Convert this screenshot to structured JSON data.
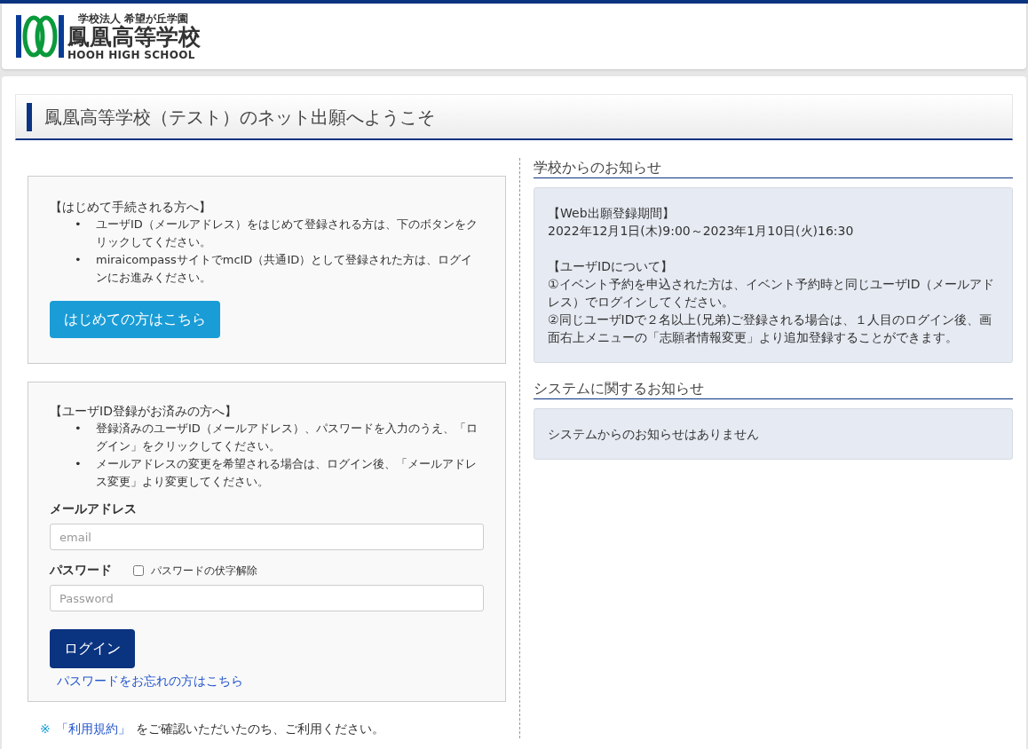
{
  "header": {
    "logo_caption": "学校法人 希望が丘学園",
    "logo_name": "鳳凰高等学校",
    "logo_english": "HOOH HIGH SCHOOL"
  },
  "page_title": "鳳凰高等学校（テスト）のネット出願へようこそ",
  "first_time": {
    "heading": "【はじめて手続される方へ】",
    "bullets": [
      {
        "mark": "•",
        "text": "ユーザID（メールアドレス）をはじめて登録される方は、下のボタンをクリックしてください。"
      },
      {
        "mark": "•",
        "text": "miraicompassサイトでmcID（共通ID）として登録された方は、ログインにお進みください。"
      }
    ],
    "button": "はじめての方はこちら"
  },
  "login": {
    "heading": "【ユーザID登録がお済みの方へ】",
    "bullets": [
      {
        "mark": "•",
        "text": "登録済みのユーザID（メールアドレス）、パスワードを入力のうえ、「ログイン」をクリックしてください。"
      },
      {
        "mark": "•",
        "text": "メールアドレスの変更を希望される場合は、ログイン後、「メールアドレス変更」より変更してください。"
      }
    ],
    "email_label": "メールアドレス",
    "email": {
      "placeholder": "email"
    },
    "password_label": "パスワード",
    "reveal": {
      "label": "パスワードの伏字解除",
      "checked": false
    },
    "password": {
      "placeholder": "Password"
    },
    "button": "ログイン",
    "forgot_link": "パスワードをお忘れの方はこちら"
  },
  "terms": {
    "mark": "※",
    "link": "「利用規約」",
    "text": "をご確認いただいたのち、ご利用ください。"
  },
  "notices": [
    {
      "title": "学校からのお知らせ",
      "blocks": [
        [
          "【Web出願登録期間】",
          "2022年12月1日(木)9:00～2023年1月10日(火)16:30"
        ],
        [
          "【ユーザIDについて】",
          "①イベント予約を申込された方は、イベント予約時と同じユーザID（メールアドレス）でログインしてください。",
          "②同じユーザIDで２名以上(兄弟)ご登録される場合は、１人目のログイン後、画面右上メニューの「志願者情報変更」より追加登録することができます。"
        ]
      ]
    },
    {
      "title": "システムに関するお知らせ",
      "blocks": [
        [
          "システムからのお知らせはありません"
        ]
      ]
    }
  ]
}
